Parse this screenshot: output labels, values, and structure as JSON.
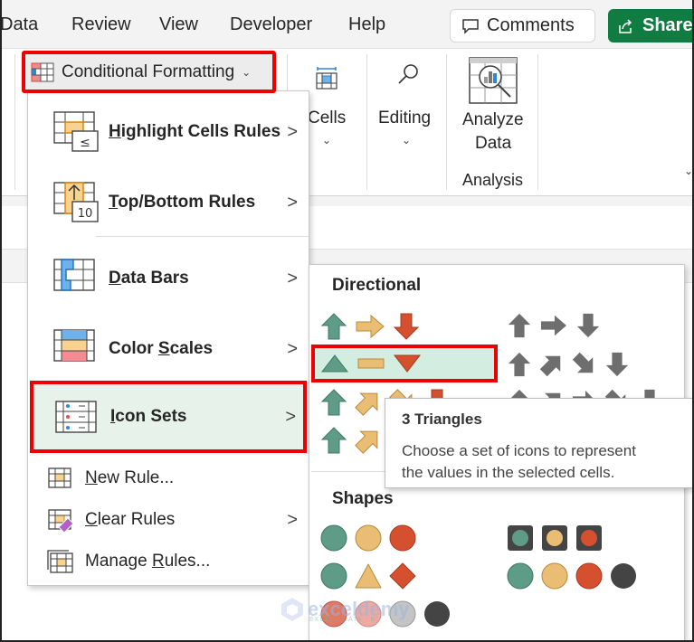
{
  "menubar": {
    "tabs": [
      "Data",
      "Review",
      "View",
      "Developer",
      "Help"
    ],
    "comments_label": "Comments",
    "share_label": "Share"
  },
  "ribbon": {
    "conditional_formatting_label": "Conditional Formatting",
    "cells_label": "Cells",
    "editing_label": "Editing",
    "analyze_data_label_1": "Analyze",
    "analyze_data_label_2": "Data",
    "analysis_group_label": "Analysis"
  },
  "cf_menu": {
    "items": [
      {
        "label": "Highlight Cells Rules",
        "accel": "H",
        "has_submenu": true
      },
      {
        "label": "Top/Bottom Rules",
        "accel": "T",
        "has_submenu": true
      },
      {
        "label": "Data Bars",
        "accel": "D",
        "has_submenu": true
      },
      {
        "label": "Color Scales",
        "accel": "S",
        "has_submenu": true
      },
      {
        "label": "Icon Sets",
        "accel": "I",
        "has_submenu": true,
        "selected": true
      },
      {
        "label": "New Rule...",
        "accel": "N",
        "has_submenu": false
      },
      {
        "label": "Clear Rules",
        "accel": "C",
        "has_submenu": true
      },
      {
        "label": "Manage Rules...",
        "accel": "R",
        "has_submenu": false
      }
    ]
  },
  "icon_sets": {
    "sections": [
      {
        "title": "Directional"
      },
      {
        "title": "Shapes"
      }
    ],
    "selected_set": "3 Triangles",
    "colors": {
      "green": "#5e9c87",
      "yellow": "#e9bd73",
      "red": "#d4502f",
      "gray": "#6e6e6e",
      "dark": "#444444",
      "pink": "#efa9a0",
      "silver": "#c4c4c4"
    }
  },
  "tooltip": {
    "title": "3 Triangles",
    "body_line1": "Choose a set of icons to represent",
    "body_line2": "the values in the selected cells."
  },
  "watermark": {
    "text": "exceldemy",
    "sub": "EXCEL · DATA · BI"
  }
}
